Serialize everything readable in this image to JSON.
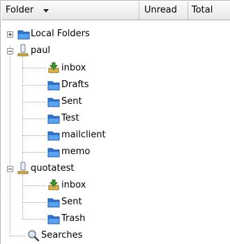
{
  "columns": {
    "folder": "Folder",
    "unread": "Unread",
    "total": "Total"
  },
  "tree": {
    "local_folders": "Local Folders",
    "paul": {
      "label": "paul",
      "children": [
        "inbox",
        "Drafts",
        "Sent",
        "Test",
        "mailclient",
        "memo"
      ]
    },
    "quotatest": {
      "label": "quotatest",
      "children": [
        "inbox",
        "Sent",
        "Trash"
      ]
    },
    "searches": "Searches"
  },
  "icons": {
    "folder": "folder-icon",
    "inbox": "inbox-icon",
    "account": "account-icon",
    "search": "magnifier-icon"
  },
  "colors": {
    "folder_blue": "#3b7fd9",
    "inbox_green": "#3a9a2c"
  }
}
